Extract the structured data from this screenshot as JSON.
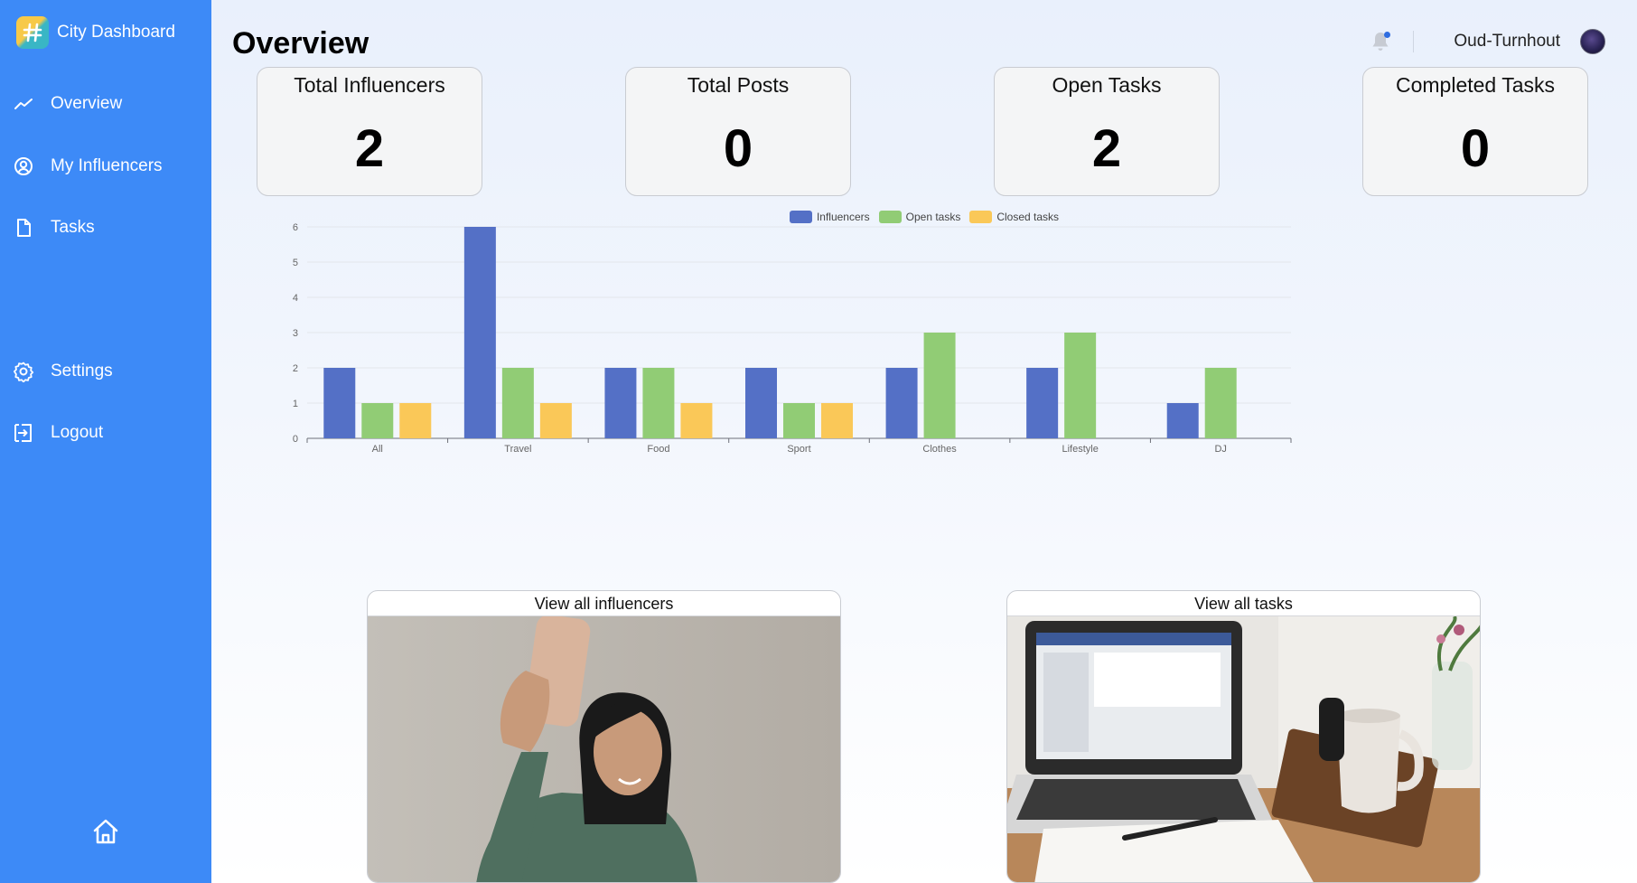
{
  "app": {
    "title": "City Dashboard"
  },
  "sidebar": {
    "items": [
      {
        "label": "Overview",
        "icon": "trend-line-icon"
      },
      {
        "label": "My Influencers",
        "icon": "user-circle-icon"
      },
      {
        "label": "Tasks",
        "icon": "document-icon"
      },
      {
        "label": "Settings",
        "icon": "gear-icon"
      },
      {
        "label": "Logout",
        "icon": "logout-icon"
      }
    ],
    "home_icon": "home-icon"
  },
  "header": {
    "title": "Overview",
    "user_name": "Oud-Turnhout",
    "notification_icon": "bell-icon"
  },
  "stats": [
    {
      "label": "Total Influencers",
      "value": "2"
    },
    {
      "label": "Total Posts",
      "value": "0"
    },
    {
      "label": "Open Tasks",
      "value": "2"
    },
    {
      "label": "Completed Tasks",
      "value": "0"
    }
  ],
  "chart_data": {
    "type": "bar",
    "categories": [
      "All",
      "Travel",
      "Food",
      "Sport",
      "Clothes",
      "Lifestyle",
      "DJ"
    ],
    "series": [
      {
        "name": "Influencers",
        "color": "#5470c6",
        "values": [
          2,
          6,
          2,
          2,
          2,
          2,
          1
        ]
      },
      {
        "name": "Open tasks",
        "color": "#91cc75",
        "values": [
          1,
          2,
          2,
          1,
          3,
          3,
          2
        ]
      },
      {
        "name": "Closed tasks",
        "color": "#fac858",
        "values": [
          1,
          1,
          1,
          1,
          0,
          0,
          0
        ]
      }
    ],
    "ylim": [
      0,
      6
    ],
    "yticks": [
      "0",
      "1",
      "2",
      "3",
      "4",
      "5",
      "6"
    ],
    "grid": true,
    "legend": "top-center"
  },
  "links": [
    {
      "label": "View all influencers"
    },
    {
      "label": "View all tasks"
    }
  ],
  "colors": {
    "sidebar": "#3d8af7",
    "influencers": "#5470c6",
    "open_tasks": "#91cc75",
    "closed_tasks": "#fac858"
  }
}
